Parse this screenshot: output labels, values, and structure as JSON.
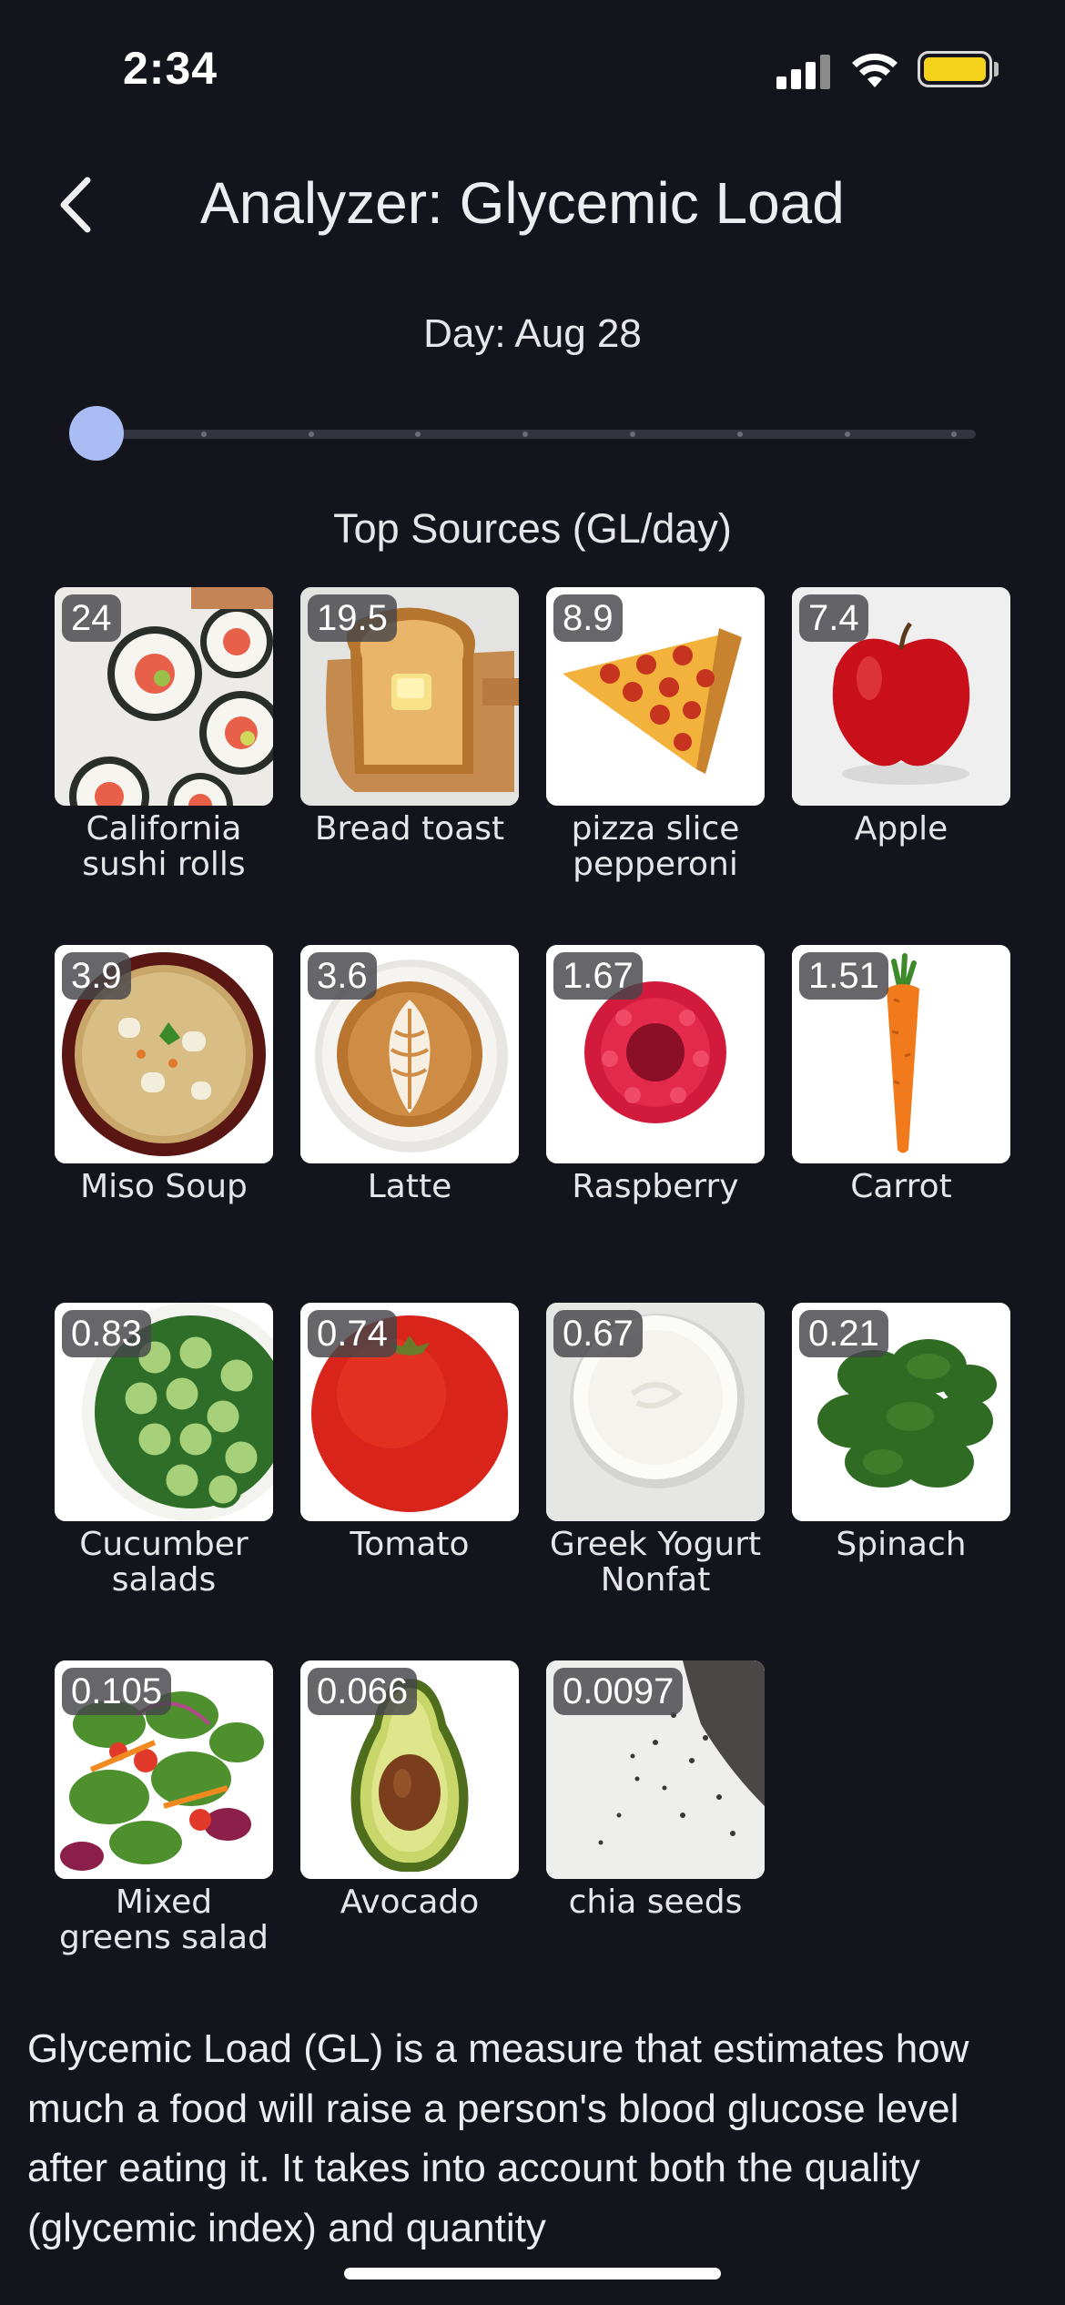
{
  "status_bar": {
    "time": "2:34"
  },
  "header": {
    "title": "Analyzer: Glycemic Load"
  },
  "day_selector": {
    "label": "Day: Aug 28",
    "slider_position": 0,
    "slider_steps": 8
  },
  "top_sources": {
    "title": "Top Sources (GL/day)",
    "items": [
      {
        "value": "24",
        "name": "California sushi rolls",
        "icon": "sushi-image"
      },
      {
        "value": "19.5",
        "name": "Bread toast",
        "icon": "toast-image"
      },
      {
        "value": "8.9",
        "name": "pizza slice pepperoni",
        "icon": "pizza-image"
      },
      {
        "value": "7.4",
        "name": "Apple",
        "icon": "apple-image"
      },
      {
        "value": "3.9",
        "name": "Miso Soup",
        "icon": "soup-image"
      },
      {
        "value": "3.6",
        "name": "Latte",
        "icon": "latte-image"
      },
      {
        "value": "1.67",
        "name": "Raspberry",
        "icon": "raspberry-image"
      },
      {
        "value": "1.51",
        "name": "Carrot",
        "icon": "carrot-image"
      },
      {
        "value": "0.83",
        "name": "Cucumber salads",
        "icon": "cucumber-image"
      },
      {
        "value": "0.74",
        "name": "Tomato",
        "icon": "tomato-image"
      },
      {
        "value": "0.67",
        "name": "Greek Yogurt Nonfat",
        "icon": "yogurt-image"
      },
      {
        "value": "0.21",
        "name": "Spinach",
        "icon": "spinach-image"
      },
      {
        "value": "0.105",
        "name": "Mixed greens salad",
        "icon": "salad-image"
      },
      {
        "value": "0.066",
        "name": "Avocado",
        "icon": "avocado-image"
      },
      {
        "value": "0.0097",
        "name": "chia seeds",
        "icon": "chia-image"
      }
    ]
  },
  "description": {
    "text": "Glycemic Load (GL) is a measure that estimates how much a food will raise a person's blood glucose level after eating it. It takes into account both the quality (glycemic index) and quantity"
  },
  "colors": {
    "background": "#14151c",
    "slider_thumb": "#a9bdf4",
    "battery": "#f4d21a"
  }
}
